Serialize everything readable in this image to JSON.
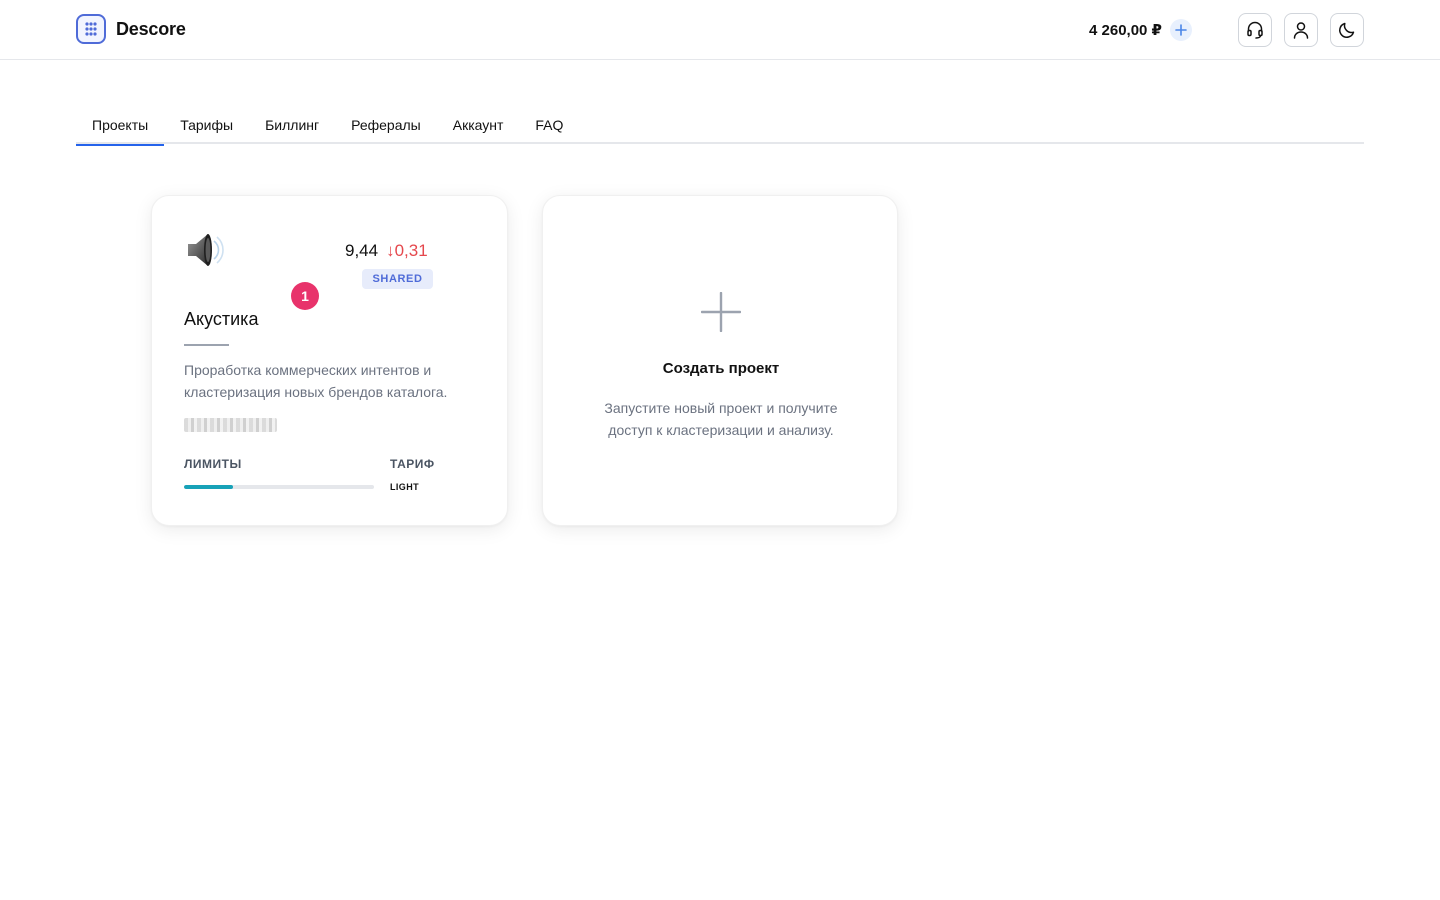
{
  "app": {
    "name": "Descore"
  },
  "header": {
    "balance": "4 260,00 ₽",
    "icons": {
      "logo": "grid-dots-icon",
      "add": "plus-icon",
      "support": "headset-icon",
      "account": "user-icon",
      "theme": "moon-icon"
    }
  },
  "tabs": [
    {
      "label": "Проекты",
      "active": true
    },
    {
      "label": "Тарифы"
    },
    {
      "label": "Биллинг"
    },
    {
      "label": "Рефералы"
    },
    {
      "label": "Аккаунт"
    },
    {
      "label": "FAQ"
    }
  ],
  "project": {
    "icon": "speaker-icon",
    "metric_value": "9,44",
    "metric_delta": "↓0,31",
    "badge": "SHARED",
    "notifications": "1",
    "name": "Акустика",
    "description": "Проработка коммерческих интентов и кластеризация новых брендов каталога.",
    "limits_label": "ЛИМИТЫ",
    "limits_used_fraction": 0.26,
    "plan_label": "ТАРИФ",
    "plan_value": "LIGHT"
  },
  "create_project": {
    "icon": "plus-icon",
    "title": "Создать проект",
    "description": "Запустите новый проект и получите доступ к кластеризации и анализу."
  },
  "colors": {
    "accent": "#2563eb",
    "delta_negative": "#e5484d",
    "limits_fill": "#17a2b8",
    "notification": "#e8336b"
  }
}
